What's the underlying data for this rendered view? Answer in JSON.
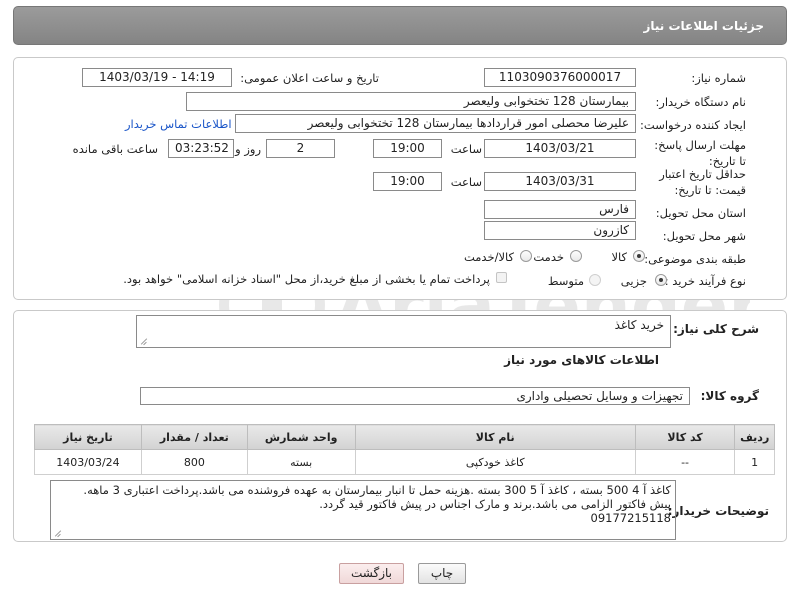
{
  "header": {
    "title": "جزئیات اطلاعات نیاز"
  },
  "fields": {
    "need_number_label": "شماره نیاز:",
    "need_number": "1103090376000017",
    "announce_label": "تاریخ و ساعت اعلان عمومی:",
    "announce_value": "1403/03/19 - 14:19",
    "buyer_label": "نام دستگاه خریدار:",
    "buyer_value": "بیمارستان 128 تختخوابی ولیعصر",
    "creator_label": "ایجاد کننده درخواست:",
    "creator_value": "علیرضا محصلی امور قراردادها بیمارستان 128 تختخوابی ولیعصر",
    "contact_link": "اطلاعات تماس خریدار",
    "deadline_label": "مهلت ارسال پاسخ: تا تاریخ:",
    "deadline_date": "1403/03/21",
    "time_label": "ساعت",
    "deadline_time": "19:00",
    "days_value": "2",
    "days_label": "روز و",
    "remaining_time": "03:23:52",
    "remaining_label": "ساعت باقی مانده",
    "validity_label": "حداقل تاریخ اعتبار قیمت: تا تاریخ:",
    "validity_date": "1403/03/31",
    "validity_time": "19:00",
    "province_label": "استان محل تحویل:",
    "province_value": "فارس",
    "city_label": "شهر محل تحویل:",
    "city_value": "کازرون",
    "category_label": "طبقه بندی موضوعی:",
    "category_options": [
      "کالا",
      "خدمت",
      "کالا/خدمت"
    ],
    "category_selected": "کالا",
    "process_label": "نوع فرآیند خرید :",
    "process_options": [
      "جزیی",
      "متوسط"
    ],
    "process_selected": "جزیی",
    "payment_note": "پرداخت تمام یا بخشی از مبلغ خرید،از محل \"اسناد خزانه اسلامی\" خواهد بود."
  },
  "summary": {
    "label": "شرح کلی نیاز:",
    "value": "خرید کاغذ"
  },
  "goods_info_title": "اطلاعات کالاهای مورد نیاز",
  "goods_group": {
    "label": "گروه کالا:",
    "value": "تجهیزات و وسایل تحصیلی واداری"
  },
  "table": {
    "headers": [
      "ردیف",
      "کد کالا",
      "نام کالا",
      "واحد شمارش",
      "تعداد / مقدار",
      "تاریخ نیاز"
    ],
    "rows": [
      [
        "1",
        "--",
        "کاغذ خودکپی",
        "بسته",
        "800",
        "1403/03/24"
      ]
    ]
  },
  "buyer_notes": {
    "label": "توضیحات خریدار:",
    "lines": [
      "کاغذ آ 4 500 بسته ، کاغذ آ 5 300 بسته .هزینه حمل تا انبار بیمارستان به عهده فروشنده می باشد.پرداخت اعتباری 3 ماهه.",
      "پیش فاکتور الزامی می باشد.برند و مارک اجناس در پیش فاکتور قید گردد.",
      "09177215118"
    ]
  },
  "buttons": {
    "print": "چاپ",
    "back": "بازگشت"
  },
  "watermark": "AriaTender.net",
  "colors": {
    "header_bg": "#8d8d8d",
    "link": "#1a55c8",
    "back_btn": "#f7e4e4"
  }
}
